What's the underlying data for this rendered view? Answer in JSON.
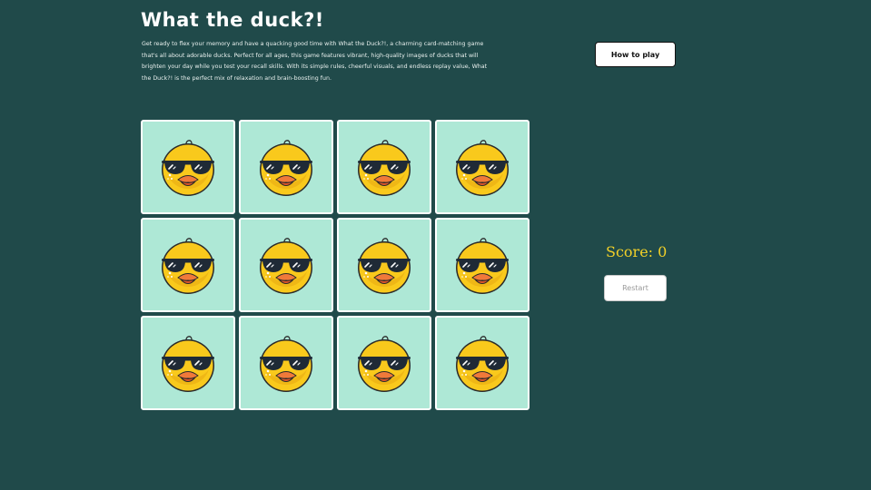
{
  "header": {
    "title": "What the duck?!",
    "description": "Get ready to flex your memory and have a quacking good time with What the Duck?!, a charming card-matching game that's all about adorable ducks. Perfect for all ages, this game features vibrant, high-quality images of ducks that will brighten your day while you test your recall skills. With its simple rules, cheerful visuals, and endless replay value, What the Duck?! is the perfect mix of relaxation and brain-boosting fun."
  },
  "controls": {
    "how_to_play": "How to play",
    "score_text": "Score: 0",
    "restart": "Restart"
  },
  "board": {
    "cards": [
      {
        "image": "duck-sunglasses-icon"
      },
      {
        "image": "duck-sunglasses-icon"
      },
      {
        "image": "duck-sunglasses-icon"
      },
      {
        "image": "duck-sunglasses-icon"
      },
      {
        "image": "duck-sunglasses-icon"
      },
      {
        "image": "duck-sunglasses-icon"
      },
      {
        "image": "duck-sunglasses-icon"
      },
      {
        "image": "duck-sunglasses-icon"
      },
      {
        "image": "duck-sunglasses-icon"
      },
      {
        "image": "duck-sunglasses-icon"
      },
      {
        "image": "duck-sunglasses-icon"
      },
      {
        "image": "duck-sunglasses-icon"
      }
    ]
  },
  "colors": {
    "background": "#204a4a",
    "card": "#aee8d6",
    "score": "#f2d028",
    "duck_body": "#f9c91c",
    "beak": "#f0793a"
  }
}
